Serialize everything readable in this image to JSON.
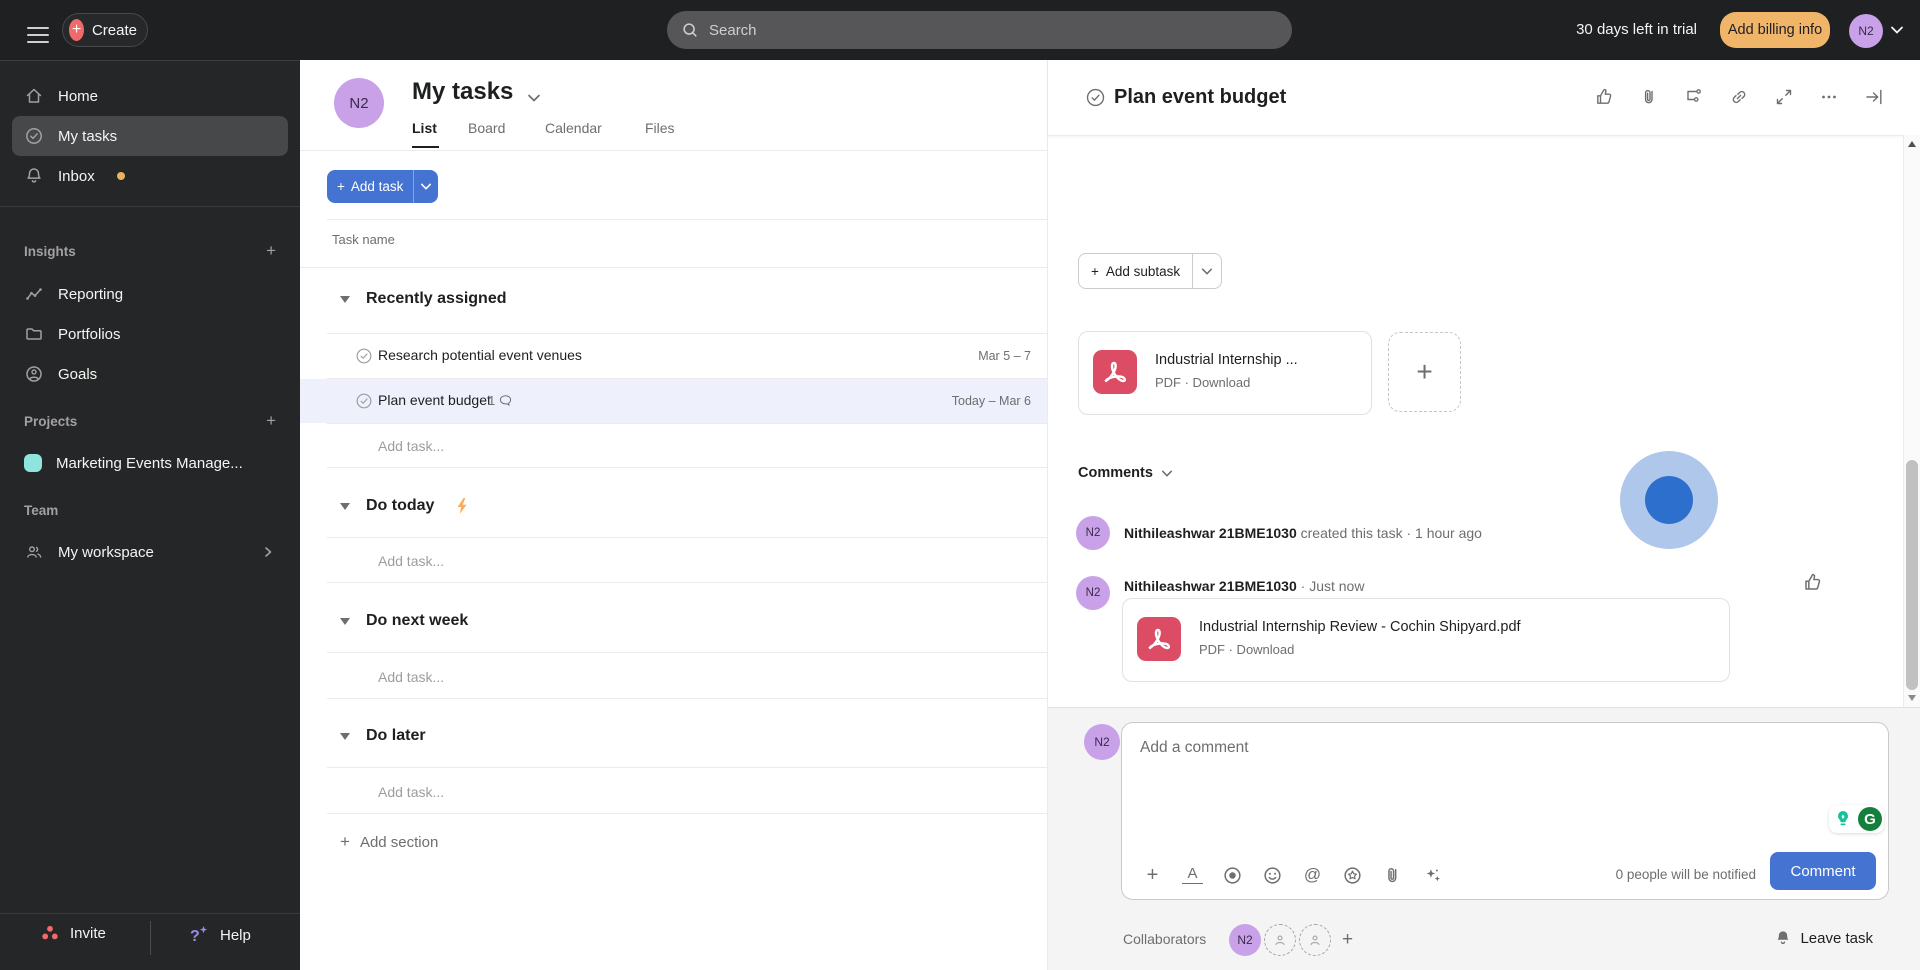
{
  "colors": {
    "accent_blue": "#4573d2",
    "coral": "#f06a6a",
    "billing_amber": "#f1b56a",
    "avatar_purple": "#c9a1e9",
    "project_teal": "#8fe5dd",
    "pdf_red": "#dc4c64",
    "bolt_amber": "#f8af5d",
    "grammarly_green": "#15803d",
    "highlight_outer": "#a9c3e9",
    "highlight_inner": "#1b63c8"
  },
  "topbar": {
    "create_label": "Create",
    "search_placeholder": "Search",
    "trial_text": "30 days left in trial",
    "billing_label": "Add billing info",
    "avatar_initials": "N2"
  },
  "sidebar": {
    "items": [
      {
        "label": "Home"
      },
      {
        "label": "My tasks"
      },
      {
        "label": "Inbox"
      }
    ],
    "insights_header": "Insights",
    "insights_items": [
      {
        "label": "Reporting"
      },
      {
        "label": "Portfolios"
      },
      {
        "label": "Goals"
      }
    ],
    "projects_header": "Projects",
    "projects_items": [
      {
        "label": "Marketing Events Manage..."
      }
    ],
    "team_header": "Team",
    "workspace_label": "My workspace",
    "invite_label": "Invite",
    "help_label": "Help"
  },
  "main": {
    "avatar_initials": "N2",
    "title": "My tasks",
    "tabs": [
      {
        "label": "List"
      },
      {
        "label": "Board"
      },
      {
        "label": "Calendar"
      },
      {
        "label": "Files"
      }
    ],
    "add_task_label": "Add task",
    "column_header": "Task name",
    "sections": [
      {
        "name": "Recently assigned",
        "tasks": [
          {
            "title": "Research potential event venues",
            "date": "Mar 5 – 7"
          },
          {
            "title": "Plan event budget",
            "comment_count": "1",
            "date": "Today – Mar 6"
          }
        ],
        "add_task_label": "Add task..."
      },
      {
        "name": "Do today",
        "add_task_label": "Add task..."
      },
      {
        "name": "Do next week",
        "add_task_label": "Add task..."
      },
      {
        "name": "Do later",
        "add_task_label": "Add task..."
      }
    ],
    "add_section_label": "Add section"
  },
  "detail": {
    "title": "Plan event budget",
    "add_subtask_label": "Add subtask",
    "attachment_card": {
      "name": "Industrial Internship ...",
      "meta": "PDF · Download"
    },
    "comments_header": "Comments",
    "activity": [
      {
        "initials": "N2",
        "name": "Nithileashwar 21BME1030",
        "action": "created this task",
        "time": "· 1 hour ago"
      },
      {
        "initials": "N2",
        "name": "Nithileashwar 21BME1030",
        "time": "· Just now",
        "attachment": {
          "name": "Industrial Internship Review - Cochin Shipyard.pdf",
          "meta": "PDF · Download"
        }
      }
    ],
    "composer": {
      "avatar_initials": "N2",
      "placeholder": "Add a comment",
      "notify_text": "0 people will be notified",
      "submit_label": "Comment"
    },
    "collaborators_label": "Collaborators",
    "collaborator_initials": "N2",
    "leave_task_label": "Leave task"
  }
}
